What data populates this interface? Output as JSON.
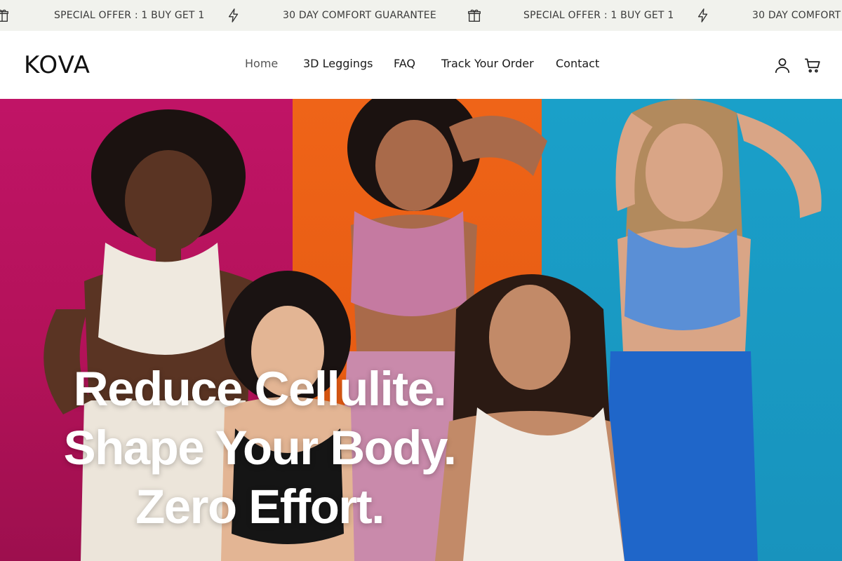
{
  "announcement": {
    "offer_text": "SPECIAL OFFER : 1 BUY GET 1",
    "guarantee_text": "30 DAY COMFORT GUARANTEE",
    "icons": [
      "gift-icon",
      "lightning-icon"
    ],
    "background": "#f1f2ed"
  },
  "header": {
    "logo": "KOVA",
    "nav": [
      {
        "label": "Home",
        "active": true
      },
      {
        "label": "3D Leggings"
      },
      {
        "label": "FAQ"
      },
      {
        "label": "Track Your Order"
      },
      {
        "label": "Contact"
      }
    ],
    "icons": [
      "account-icon",
      "cart-icon"
    ]
  },
  "hero": {
    "title_lines": [
      "Reduce Cellulite.",
      "Shape Your Body.",
      "Zero Effort."
    ],
    "colors": {
      "pink": "#b31259",
      "orange": "#e2570f",
      "blue": "#1893bd"
    }
  }
}
